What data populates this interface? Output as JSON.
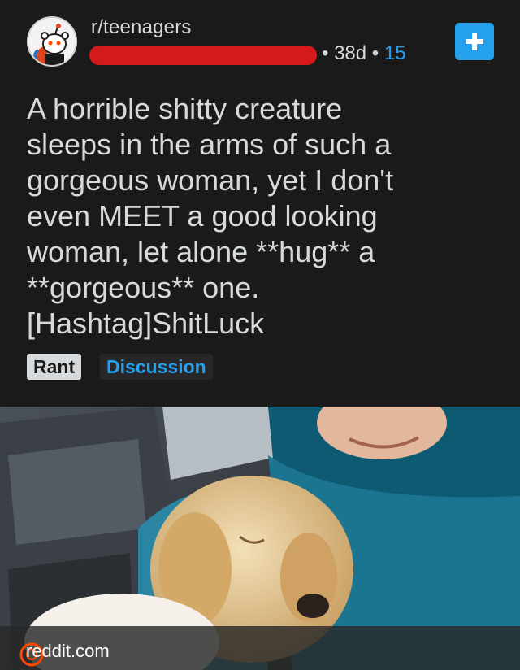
{
  "post": {
    "subreddit": "r/teenagers",
    "age": "38d",
    "comment_count": "15",
    "separator": "•",
    "title": "A horrible shitty creature\nsleeps in the arms of such a\ngorgeous woman, yet I don't\neven MEET a good looking\nwoman, let alone **hug** a\n**gorgeous** one.\n[Hashtag]ShitLuck",
    "flairs": [
      "Rant",
      "Discussion"
    ]
  },
  "link": {
    "domain": "reddit.com"
  },
  "colors": {
    "background": "#1a1a1b",
    "text": "#d7dadc",
    "accent": "#24a0ed",
    "redaction": "#d41a1a"
  },
  "icons": [
    "snoo-avatar-icon",
    "plus-icon",
    "reddit-logo-icon"
  ]
}
